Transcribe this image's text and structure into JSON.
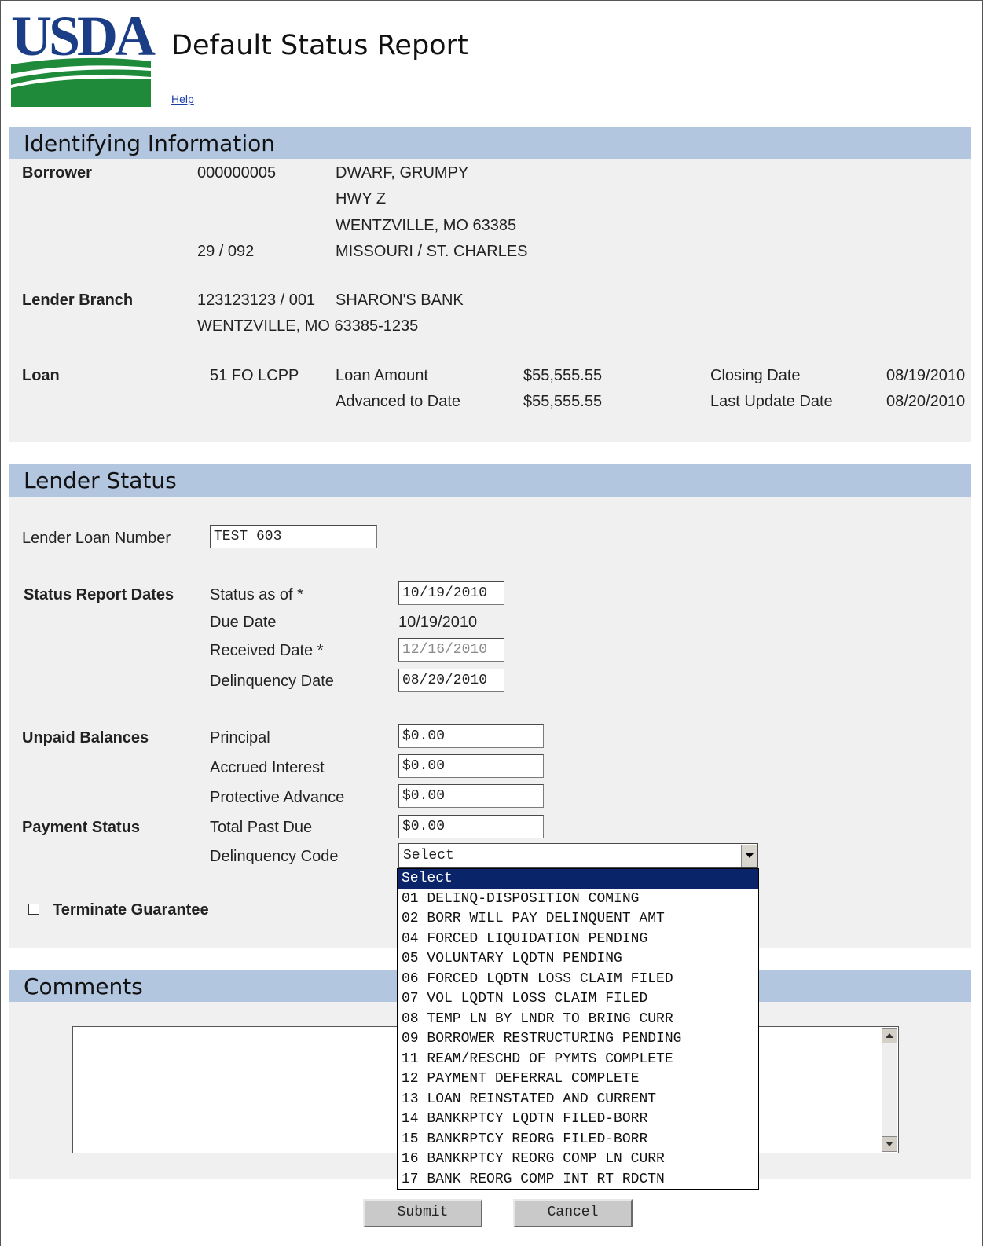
{
  "header": {
    "logo_text": "USDA",
    "title": "Default Status Report",
    "help_link": "Help"
  },
  "identifying": {
    "section_title": "Identifying Information",
    "borrower": {
      "label": "Borrower",
      "id": "000000005",
      "name": "DWARF, GRUMPY",
      "address1": "HWY Z",
      "address2": "WENTZVILLE, MO 63385",
      "state_county_code": "29 / 092",
      "state_county": "MISSOURI / ST. CHARLES"
    },
    "lender_branch": {
      "label": "Lender Branch",
      "id": "123123123 / 001",
      "name": "SHARON'S BANK",
      "address": "WENTZVILLE, MO 63385-1235"
    },
    "loan": {
      "label": "Loan",
      "code": "51 FO LCPP",
      "loan_amount_label": "Loan Amount",
      "loan_amount": "$55,555.55",
      "advanced_label": "Advanced to Date",
      "advanced": "$55,555.55",
      "closing_date_label": "Closing Date",
      "closing_date": "08/19/2010",
      "last_update_label": "Last Update Date",
      "last_update": "08/20/2010"
    }
  },
  "lender_status": {
    "section_title": "Lender Status",
    "lender_loan_number_label": "Lender Loan Number",
    "lender_loan_number": "TEST 603",
    "status_report_dates_label": "Status Report Dates",
    "status_as_of_label": "Status as of *",
    "status_as_of": "10/19/2010",
    "due_date_label": "Due Date",
    "due_date": "10/19/2010",
    "received_date_label": "Received Date *",
    "received_date": "12/16/2010",
    "delinquency_date_label": "Delinquency Date",
    "delinquency_date": "08/20/2010",
    "unpaid_balances_label": "Unpaid Balances",
    "principal_label": "Principal",
    "principal": "$0.00",
    "accrued_interest_label": "Accrued Interest",
    "accrued_interest": "$0.00",
    "protective_advance_label": "Protective Advance",
    "protective_advance": "$0.00",
    "payment_status_label": "Payment Status",
    "total_past_due_label": "Total Past Due",
    "total_past_due": "$0.00",
    "delinquency_code_label": "Delinquency Code",
    "delinquency_code_selected": "Select",
    "delinquency_code_options": [
      "Select",
      "01 DELINQ-DISPOSITION COMING",
      "02 BORR WILL PAY DELINQUENT AMT",
      "04 FORCED LIQUIDATION PENDING",
      "05 VOLUNTARY LQDTN PENDING",
      "06 FORCED LQDTN LOSS CLAIM FILED",
      "07 VOL LQDTN LOSS CLAIM FILED",
      "08 TEMP LN BY LNDR TO BRING CURR",
      "09 BORROWER RESTRUCTURING PENDING",
      "11 REAM/RESCHD OF PYMTS COMPLETE",
      "12 PAYMENT DEFERRAL COMPLETE",
      "13 LOAN REINSTATED AND CURRENT",
      "14 BANKRPTCY LQDTN FILED-BORR",
      "15 BANKRPTCY REORG FILED-BORR",
      "16 BANKRPTCY REORG COMP LN CURR",
      "17 BANK REORG COMP INT RT RDCTN"
    ],
    "terminate_guarantee_label": "Terminate Guarantee",
    "terminate_guarantee_checked": false
  },
  "comments": {
    "section_title": "Comments",
    "value": ""
  },
  "actions": {
    "submit_label": "Submit",
    "cancel_label": "Cancel"
  },
  "colors": {
    "section_band": "#b3c6e0",
    "panel_background": "#f0f0f0",
    "logo_blue": "#1a3d86",
    "logo_green": "#1f8a3a",
    "dropdown_highlight": "#0a246a"
  }
}
